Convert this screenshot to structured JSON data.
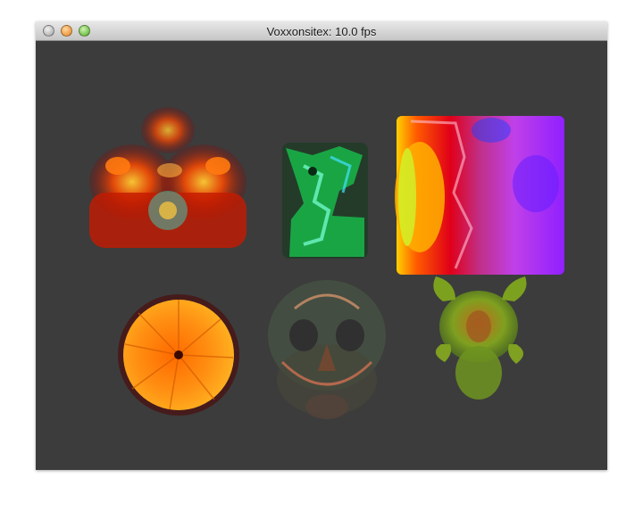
{
  "window": {
    "title": "Voxxonsitex: 10.0 fps"
  },
  "icons": {
    "close": "close-icon",
    "minimize": "minimize-icon",
    "zoom": "zoom-icon"
  },
  "renderings": [
    {
      "id": "ct-scan-red",
      "kind": "volume-render"
    },
    {
      "id": "green-animal-cast",
      "kind": "volume-render"
    },
    {
      "id": "magenta-heatmap",
      "kind": "volume-render"
    },
    {
      "id": "orange-slice",
      "kind": "volume-render"
    },
    {
      "id": "skull",
      "kind": "volume-render"
    },
    {
      "id": "frog",
      "kind": "volume-render"
    }
  ],
  "colors": {
    "viewport_bg": "#3c3c3c",
    "titlebar_top": "#e8e8e8",
    "titlebar_bottom": "#c6c6c6"
  }
}
